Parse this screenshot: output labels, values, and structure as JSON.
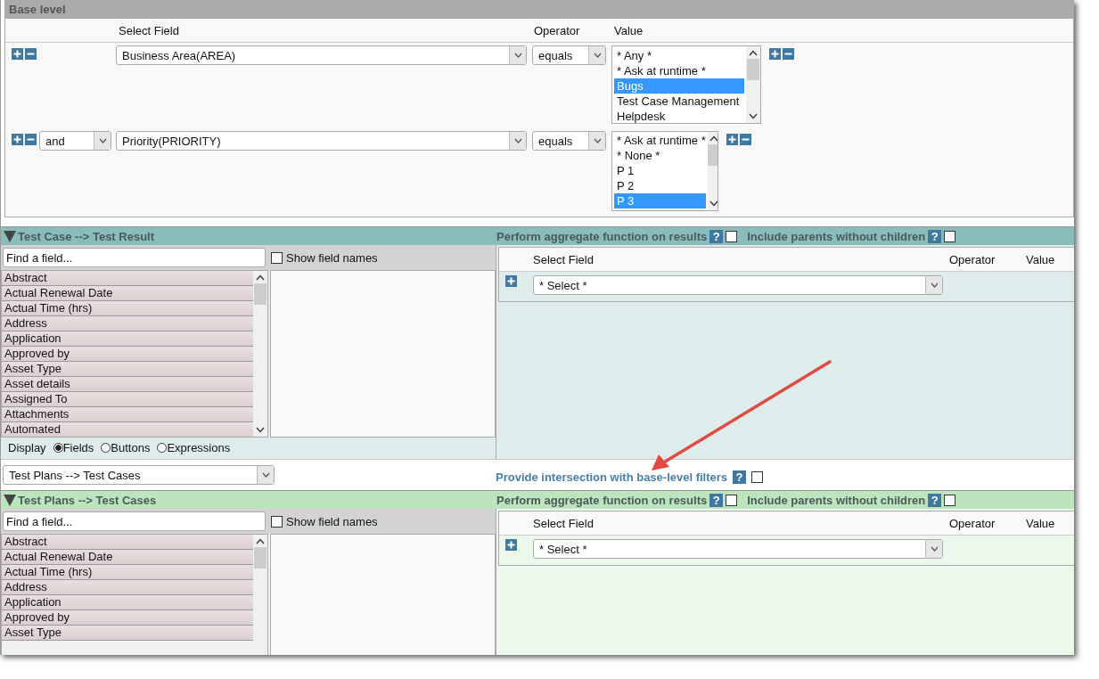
{
  "base_level": {
    "title": "Base level",
    "columns": [
      "Select Field",
      "Operator",
      "Value"
    ],
    "rows": [
      {
        "field": "Business Area(AREA)",
        "operator": "equals",
        "values": [
          {
            "label": "* Any *",
            "selected": false
          },
          {
            "label": "* Ask at runtime *",
            "selected": false
          },
          {
            "label": "Bugs",
            "selected": true
          },
          {
            "label": "Test Case Management",
            "selected": false
          },
          {
            "label": "Helpdesk",
            "selected": false
          }
        ]
      },
      {
        "conjunction": "and",
        "field": "Priority(PRIORITY)",
        "operator": "equals",
        "values": [
          {
            "label": "* Ask at runtime *",
            "selected": false
          },
          {
            "label": "* None *",
            "selected": false
          },
          {
            "label": "P 1",
            "selected": false
          },
          {
            "label": "P 2",
            "selected": false
          },
          {
            "label": "P 3",
            "selected": true
          }
        ]
      }
    ]
  },
  "sections": [
    {
      "title": "Test Case --> Test Result",
      "color": "#8bbcbc",
      "expanded": true,
      "aggregate": {
        "label": "Perform aggregate function on results",
        "help": "?",
        "checked": false
      },
      "include_parents": {
        "label": "Include parents without children",
        "help": "?",
        "checked": false
      },
      "search": {
        "placeholder": "Find a field..."
      },
      "show_field_names": {
        "label": "Show field names",
        "checked": false
      },
      "fields": [
        "Abstract",
        "Actual Renewal Date",
        "Actual Time (hrs)",
        "Address",
        "Application",
        "Approved by",
        "Asset Type",
        "Asset details",
        "Assigned To",
        "Attachments",
        "Automated"
      ],
      "display": {
        "label": "Display",
        "options": [
          {
            "label": "Fields",
            "selected": true
          },
          {
            "label": "Buttons",
            "selected": false
          },
          {
            "label": "Expressions",
            "selected": false
          }
        ]
      },
      "filter": {
        "columns": [
          "Select Field",
          "Operator",
          "Value"
        ],
        "field": "* Select *"
      }
    },
    {
      "title": "Test Plans --> Test Cases",
      "color": "#bde5bd",
      "expanded": true,
      "aggregate": {
        "label": "Perform aggregate function on results",
        "help": "?",
        "checked": false
      },
      "include_parents": {
        "label": "Include parents without children",
        "help": "?",
        "checked": false
      },
      "search": {
        "placeholder": "Find a field..."
      },
      "show_field_names": {
        "label": "Show field names",
        "checked": false
      },
      "fields": [
        "Abstract",
        "Actual Renewal Date",
        "Actual Time (hrs)",
        "Address",
        "Application",
        "Approved by",
        "Asset Type"
      ],
      "filter": {
        "columns": [
          "Select Field",
          "Operator",
          "Value"
        ],
        "field": "* Select *"
      }
    }
  ],
  "relation": {
    "value": "Test Plans --> Test Cases",
    "intersection": {
      "label": "Provide intersection with base-level filters",
      "help": "?",
      "checked": false
    }
  }
}
